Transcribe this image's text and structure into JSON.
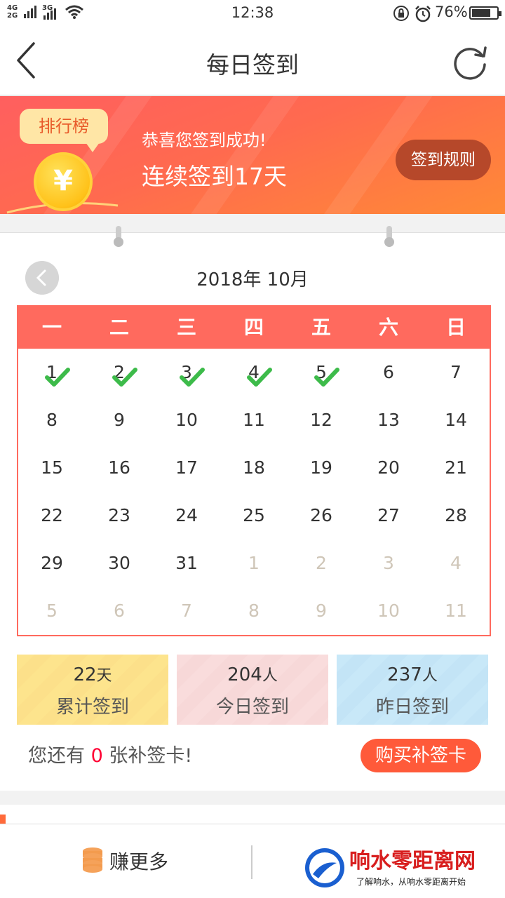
{
  "status_bar": {
    "network": [
      "4G",
      "2G"
    ],
    "network2": "3G",
    "time": "12:38",
    "battery_percent": "76%",
    "battery_level": 0.76
  },
  "header": {
    "title": "每日签到",
    "back_icon": "chevron-left-icon",
    "refresh_icon": "refresh-icon"
  },
  "banner": {
    "rank_label": "排行榜",
    "coin_symbol": "¥",
    "congrats": "恭喜您签到成功!",
    "streak": "连续签到17天",
    "rules_button": "签到规则",
    "colors": {
      "start": "#ff5f5f",
      "end": "#ff8a36"
    }
  },
  "calendar": {
    "month_label": "2018年 10月",
    "weekdays": [
      "一",
      "二",
      "三",
      "四",
      "五",
      "六",
      "日"
    ],
    "days": [
      {
        "d": "1",
        "checked": true,
        "dim": false
      },
      {
        "d": "2",
        "checked": true,
        "dim": false
      },
      {
        "d": "3",
        "checked": true,
        "dim": false
      },
      {
        "d": "4",
        "checked": true,
        "dim": false
      },
      {
        "d": "5",
        "checked": true,
        "dim": false
      },
      {
        "d": "6",
        "checked": false,
        "dim": false
      },
      {
        "d": "7",
        "checked": false,
        "dim": false
      },
      {
        "d": "8",
        "checked": false,
        "dim": false
      },
      {
        "d": "9",
        "checked": false,
        "dim": false
      },
      {
        "d": "10",
        "checked": false,
        "dim": false
      },
      {
        "d": "11",
        "checked": false,
        "dim": false
      },
      {
        "d": "12",
        "checked": false,
        "dim": false
      },
      {
        "d": "13",
        "checked": false,
        "dim": false
      },
      {
        "d": "14",
        "checked": false,
        "dim": false
      },
      {
        "d": "15",
        "checked": false,
        "dim": false
      },
      {
        "d": "16",
        "checked": false,
        "dim": false
      },
      {
        "d": "17",
        "checked": false,
        "dim": false
      },
      {
        "d": "18",
        "checked": false,
        "dim": false
      },
      {
        "d": "19",
        "checked": false,
        "dim": false
      },
      {
        "d": "20",
        "checked": false,
        "dim": false
      },
      {
        "d": "21",
        "checked": false,
        "dim": false
      },
      {
        "d": "22",
        "checked": false,
        "dim": false
      },
      {
        "d": "23",
        "checked": false,
        "dim": false
      },
      {
        "d": "24",
        "checked": false,
        "dim": false
      },
      {
        "d": "25",
        "checked": false,
        "dim": false
      },
      {
        "d": "26",
        "checked": false,
        "dim": false
      },
      {
        "d": "27",
        "checked": false,
        "dim": false
      },
      {
        "d": "28",
        "checked": false,
        "dim": false
      },
      {
        "d": "29",
        "checked": false,
        "dim": false
      },
      {
        "d": "30",
        "checked": false,
        "dim": false
      },
      {
        "d": "31",
        "checked": false,
        "dim": false
      },
      {
        "d": "1",
        "checked": false,
        "dim": true
      },
      {
        "d": "2",
        "checked": false,
        "dim": true
      },
      {
        "d": "3",
        "checked": false,
        "dim": true
      },
      {
        "d": "4",
        "checked": false,
        "dim": true
      },
      {
        "d": "5",
        "checked": false,
        "dim": true
      },
      {
        "d": "6",
        "checked": false,
        "dim": true
      },
      {
        "d": "7",
        "checked": false,
        "dim": true
      },
      {
        "d": "8",
        "checked": false,
        "dim": true
      },
      {
        "d": "9",
        "checked": false,
        "dim": true
      },
      {
        "d": "10",
        "checked": false,
        "dim": true
      },
      {
        "d": "11",
        "checked": false,
        "dim": true
      }
    ],
    "accent": "#ff6a5e",
    "check_color": "#3dbb4a"
  },
  "stats": [
    {
      "value": "22",
      "unit": "天",
      "label": "累计签到"
    },
    {
      "value": "204",
      "unit": "人",
      "label": "今日签到"
    },
    {
      "value": "237",
      "unit": "人",
      "label": "昨日签到"
    }
  ],
  "makeup": {
    "prefix": "您还有",
    "count": "0",
    "suffix": "张补签卡!",
    "buy_button": "购买补签卡"
  },
  "bottom_nav": {
    "earn_label": "赚更多"
  },
  "watermark": {
    "title": "响水零距离网",
    "slogan": "了解响水，从响水零距离开始"
  }
}
